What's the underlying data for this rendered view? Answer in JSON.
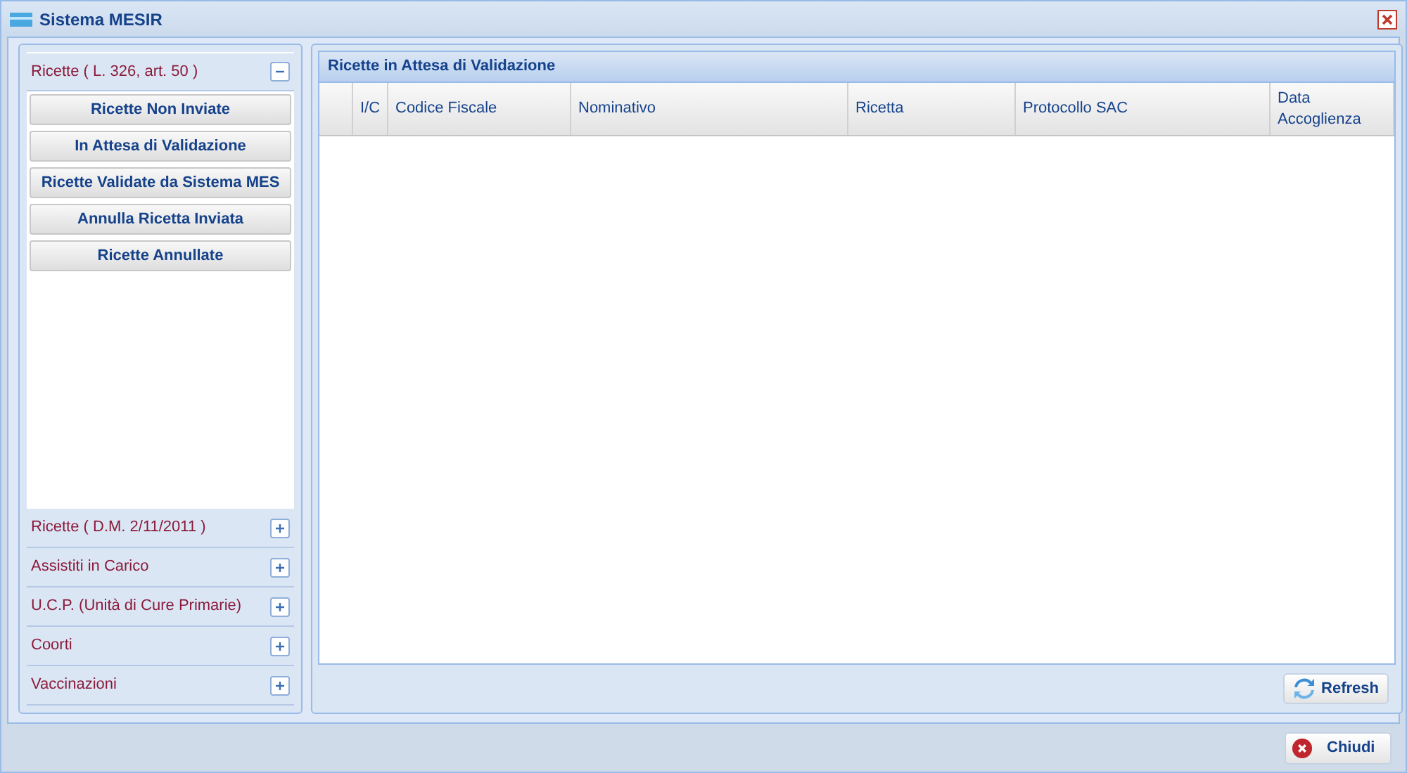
{
  "window": {
    "title": "Sistema MESIR"
  },
  "sections": [
    {
      "title": "Ricette ( L. 326, art. 50 )",
      "expanded": true,
      "items": [
        "Ricette Non Inviate",
        "In Attesa di Validazione",
        "Ricette Validate da Sistema MES",
        "Annulla Ricetta Inviata",
        "Ricette Annullate"
      ]
    },
    {
      "title": "Ricette ( D.M. 2/11/2011 )",
      "expanded": false
    },
    {
      "title": "Assistiti in Carico",
      "expanded": false
    },
    {
      "title": "U.C.P. (Unità di Cure Primarie)",
      "expanded": false
    },
    {
      "title": "Coorti",
      "expanded": false
    },
    {
      "title": "Vaccinazioni",
      "expanded": false
    }
  ],
  "panel": {
    "title": "Ricette in Attesa di Validazione"
  },
  "table": {
    "columns": [
      "",
      "I/C",
      "Codice Fiscale",
      "Nominativo",
      "Ricetta",
      "Protocollo SAC",
      "Data Accoglienza"
    ]
  },
  "refresh_button": "Refresh",
  "close_button": "Chiudi"
}
